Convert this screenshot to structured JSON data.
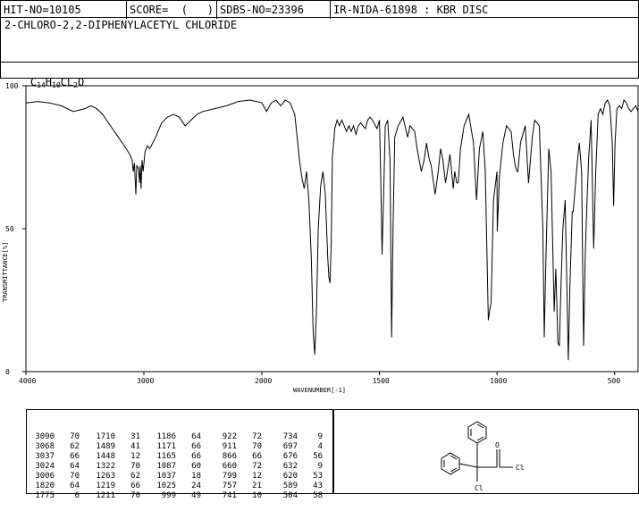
{
  "header": {
    "hit_no": "HIT-NO=10105",
    "score": "SCORE=  (   )",
    "sdbs_no": "SDBS-NO=23396",
    "ir_id": "IR-NIDA-61898 : KBR DISC"
  },
  "compound_name": "2-CHLORO-2,2-DIPHENYLACETYL CHLORIDE",
  "formula": {
    "parts": [
      "C",
      "14",
      "H",
      "10",
      "CL",
      "2",
      "O"
    ]
  },
  "chart_data": {
    "type": "line",
    "xlabel": "WAVENUMBER[-1]",
    "ylabel": "TRANSMITTANCE[%]",
    "xlim": [
      4000,
      400
    ],
    "ylim": [
      0,
      100
    ],
    "x_ticks": [
      "4000",
      "3000",
      "2000",
      "1500",
      "1000",
      "500"
    ],
    "y_ticks": [
      "100",
      "50",
      "0"
    ],
    "spectrum": [
      [
        4000,
        94
      ],
      [
        3900,
        94.5
      ],
      [
        3800,
        94
      ],
      [
        3700,
        93
      ],
      [
        3600,
        91
      ],
      [
        3500,
        92
      ],
      [
        3450,
        93
      ],
      [
        3400,
        92
      ],
      [
        3350,
        90
      ],
      [
        3300,
        87
      ],
      [
        3250,
        84
      ],
      [
        3200,
        81
      ],
      [
        3150,
        78
      ],
      [
        3120,
        76
      ],
      [
        3100,
        74
      ],
      [
        3090,
        70
      ],
      [
        3080,
        73
      ],
      [
        3068,
        62
      ],
      [
        3060,
        72
      ],
      [
        3045,
        71
      ],
      [
        3037,
        66
      ],
      [
        3030,
        72
      ],
      [
        3024,
        64
      ],
      [
        3015,
        74
      ],
      [
        3006,
        70
      ],
      [
        2990,
        77
      ],
      [
        2970,
        79
      ],
      [
        2950,
        78
      ],
      [
        2900,
        82
      ],
      [
        2850,
        87
      ],
      [
        2800,
        89
      ],
      [
        2750,
        90
      ],
      [
        2700,
        89
      ],
      [
        2650,
        86
      ],
      [
        2600,
        88
      ],
      [
        2550,
        90
      ],
      [
        2500,
        91
      ],
      [
        2400,
        92
      ],
      [
        2300,
        93
      ],
      [
        2200,
        94.5
      ],
      [
        2100,
        95
      ],
      [
        2000,
        94
      ],
      [
        1980,
        91
      ],
      [
        1960,
        94
      ],
      [
        1940,
        95
      ],
      [
        1920,
        93
      ],
      [
        1900,
        95
      ],
      [
        1880,
        94
      ],
      [
        1860,
        90
      ],
      [
        1850,
        82
      ],
      [
        1840,
        74
      ],
      [
        1830,
        68
      ],
      [
        1820,
        64
      ],
      [
        1810,
        70
      ],
      [
        1800,
        60
      ],
      [
        1790,
        40
      ],
      [
        1782,
        14
      ],
      [
        1775,
        6
      ],
      [
        1768,
        20
      ],
      [
        1760,
        50
      ],
      [
        1750,
        65
      ],
      [
        1740,
        70
      ],
      [
        1730,
        62
      ],
      [
        1720,
        40
      ],
      [
        1715,
        33
      ],
      [
        1710,
        31
      ],
      [
        1705,
        45
      ],
      [
        1700,
        75
      ],
      [
        1690,
        85
      ],
      [
        1680,
        88
      ],
      [
        1670,
        86
      ],
      [
        1660,
        88
      ],
      [
        1650,
        86
      ],
      [
        1640,
        84
      ],
      [
        1630,
        86
      ],
      [
        1620,
        84
      ],
      [
        1610,
        86
      ],
      [
        1600,
        83
      ],
      [
        1590,
        86
      ],
      [
        1580,
        87
      ],
      [
        1570,
        86
      ],
      [
        1560,
        85
      ],
      [
        1550,
        88
      ],
      [
        1540,
        89
      ],
      [
        1530,
        88
      ],
      [
        1510,
        85
      ],
      [
        1500,
        88
      ],
      [
        1495,
        70
      ],
      [
        1489,
        41
      ],
      [
        1482,
        62
      ],
      [
        1475,
        86
      ],
      [
        1465,
        88
      ],
      [
        1455,
        74
      ],
      [
        1448,
        12
      ],
      [
        1442,
        50
      ],
      [
        1435,
        82
      ],
      [
        1420,
        86
      ],
      [
        1400,
        89
      ],
      [
        1380,
        82
      ],
      [
        1370,
        86
      ],
      [
        1350,
        84
      ],
      [
        1340,
        78
      ],
      [
        1322,
        70
      ],
      [
        1310,
        74
      ],
      [
        1300,
        80
      ],
      [
        1290,
        75
      ],
      [
        1280,
        72
      ],
      [
        1263,
        62
      ],
      [
        1250,
        70
      ],
      [
        1240,
        78
      ],
      [
        1230,
        74
      ],
      [
        1219,
        66
      ],
      [
        1211,
        70
      ],
      [
        1200,
        76
      ],
      [
        1186,
        64
      ],
      [
        1180,
        70
      ],
      [
        1171,
        66
      ],
      [
        1165,
        66
      ],
      [
        1155,
        78
      ],
      [
        1140,
        86
      ],
      [
        1120,
        90
      ],
      [
        1100,
        80
      ],
      [
        1087,
        60
      ],
      [
        1075,
        78
      ],
      [
        1060,
        84
      ],
      [
        1050,
        70
      ],
      [
        1037,
        18
      ],
      [
        1030,
        22
      ],
      [
        1025,
        24
      ],
      [
        1015,
        60
      ],
      [
        1000,
        70
      ],
      [
        999,
        49
      ],
      [
        990,
        68
      ],
      [
        975,
        80
      ],
      [
        960,
        86
      ],
      [
        940,
        84
      ],
      [
        930,
        76
      ],
      [
        922,
        72
      ],
      [
        915,
        70
      ],
      [
        911,
        70
      ],
      [
        900,
        80
      ],
      [
        880,
        86
      ],
      [
        866,
        66
      ],
      [
        860,
        72
      ],
      [
        850,
        82
      ],
      [
        840,
        88
      ],
      [
        820,
        86
      ],
      [
        805,
        50
      ],
      [
        799,
        12
      ],
      [
        792,
        40
      ],
      [
        780,
        78
      ],
      [
        770,
        70
      ],
      [
        757,
        21
      ],
      [
        750,
        36
      ],
      [
        741,
        10
      ],
      [
        735,
        9
      ],
      [
        728,
        30
      ],
      [
        720,
        50
      ],
      [
        710,
        60
      ],
      [
        697,
        4
      ],
      [
        690,
        30
      ],
      [
        680,
        56
      ],
      [
        676,
        56
      ],
      [
        670,
        62
      ],
      [
        660,
        72
      ],
      [
        650,
        80
      ],
      [
        640,
        70
      ],
      [
        632,
        9
      ],
      [
        625,
        40
      ],
      [
        620,
        53
      ],
      [
        610,
        75
      ],
      [
        600,
        88
      ],
      [
        589,
        43
      ],
      [
        580,
        70
      ],
      [
        570,
        90
      ],
      [
        560,
        92
      ],
      [
        550,
        90
      ],
      [
        540,
        94
      ],
      [
        530,
        95
      ],
      [
        520,
        93
      ],
      [
        510,
        80
      ],
      [
        504,
        58
      ],
      [
        498,
        80
      ],
      [
        490,
        92
      ],
      [
        480,
        93
      ],
      [
        470,
        92
      ],
      [
        460,
        95
      ],
      [
        450,
        94
      ],
      [
        440,
        92
      ],
      [
        430,
        91
      ],
      [
        420,
        92
      ],
      [
        410,
        93
      ],
      [
        400,
        91
      ]
    ],
    "peak_table": [
      [
        [
          "3090",
          "70"
        ],
        [
          "1710",
          "31"
        ],
        [
          "1186",
          "64"
        ],
        [
          "922",
          "72"
        ],
        [
          "734",
          "9"
        ]
      ],
      [
        [
          "3068",
          "62"
        ],
        [
          "1489",
          "41"
        ],
        [
          "1171",
          "66"
        ],
        [
          "911",
          "70"
        ],
        [
          "697",
          "4"
        ]
      ],
      [
        [
          "3037",
          "66"
        ],
        [
          "1448",
          "12"
        ],
        [
          "1165",
          "66"
        ],
        [
          "866",
          "66"
        ],
        [
          "676",
          "56"
        ]
      ],
      [
        [
          "3024",
          "64"
        ],
        [
          "1322",
          "70"
        ],
        [
          "1087",
          "60"
        ],
        [
          "660",
          "72"
        ],
        [
          "632",
          "9"
        ]
      ],
      [
        [
          "3006",
          "70"
        ],
        [
          "1263",
          "62"
        ],
        [
          "1037",
          "18"
        ],
        [
          "799",
          "12"
        ],
        [
          "620",
          "53"
        ]
      ],
      [
        [
          "1820",
          "64"
        ],
        [
          "1219",
          "66"
        ],
        [
          "1025",
          "24"
        ],
        [
          "757",
          "21"
        ],
        [
          "589",
          "43"
        ]
      ],
      [
        [
          "1775",
          "6"
        ],
        [
          "1211",
          "70"
        ],
        [
          "999",
          "49"
        ],
        [
          "741",
          "10"
        ],
        [
          "504",
          "58"
        ]
      ]
    ]
  },
  "structure": {
    "atom_o": "O",
    "atom_cl_acyl": "Cl",
    "atom_cl": "Cl"
  }
}
